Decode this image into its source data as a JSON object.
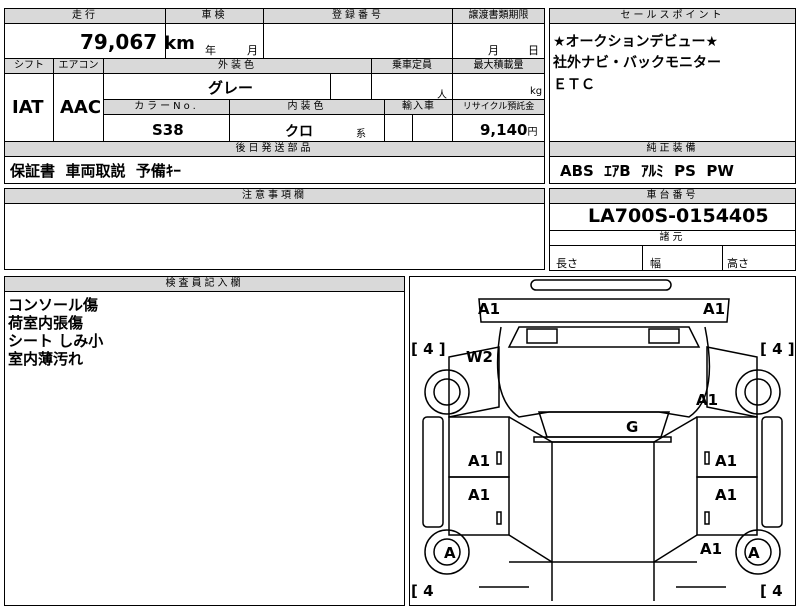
{
  "vehicle_info": {
    "mileage_label": "走行",
    "mileage_value": "79,067",
    "mileage_unit": "km",
    "inspection_label": "車検",
    "inspection_year": "年",
    "inspection_month": "月",
    "registration_label": "登録番号",
    "transfer_deadline_label": "譲渡書類期限",
    "transfer_month": "月",
    "transfer_day": "日",
    "shift_label": "シフト",
    "aircon_label": "エアコン",
    "shift_value": "IAT",
    "aircon_value": "AAC",
    "exterior_color_label": "外装色",
    "exterior_color_value": "グレー",
    "capacity_label": "乗車定員",
    "capacity_unit": "人",
    "max_load_label": "最大積載量",
    "max_load_unit": "kg",
    "color_no_label": "カラーNo.",
    "color_no_value": "S38",
    "interior_color_label": "内装色",
    "interior_color_value": "クロ",
    "interior_color_suffix": "系",
    "import_label": "輸入車",
    "recycle_label": "リサイクル預託金",
    "recycle_value": "9,140",
    "recycle_unit": "円",
    "parts_label": "後日発送部品",
    "parts_value": "保証書  車両取説  予備ｷｰ"
  },
  "sales_points": {
    "label": "セールスポイント",
    "lines": [
      "★オークションデビュー★",
      "社外ナビ・バックモニター",
      "ＥＴＣ"
    ]
  },
  "equipment": {
    "label": "純正装備",
    "value": "ABS  ｴｱB  ｱﾙﾐ  PS  PW"
  },
  "notes": {
    "label": "注意事項欄"
  },
  "chassis": {
    "label": "車台番号",
    "value": "LA700S-0154405",
    "dims_label": "諸元",
    "length_label": "長さ",
    "width_label": "幅",
    "height_label": "高さ"
  },
  "inspector": {
    "label": "検査員記入欄",
    "lines": [
      "コンソール傷",
      "荷室内張傷",
      "シート しみ小",
      "室内薄汚れ"
    ]
  },
  "diagram": {
    "marks": {
      "front_left_top": "A1",
      "front_right_top": "A1",
      "left_tire_front": "[ 4 ]",
      "right_tire_front": "[ 4 ]",
      "windshield": "W2",
      "right_fender": "A1",
      "roof": "G",
      "left_front_door": "A1",
      "right_front_door": "A1",
      "left_rear_door": "A1",
      "right_rear_door": "A1",
      "left_rear_wheel": "A",
      "right_rear_quarter": "A1",
      "right_rear_wheel": "A",
      "left_tire_rear": "[ 4",
      "right_tire_rear": "[ 4"
    }
  }
}
